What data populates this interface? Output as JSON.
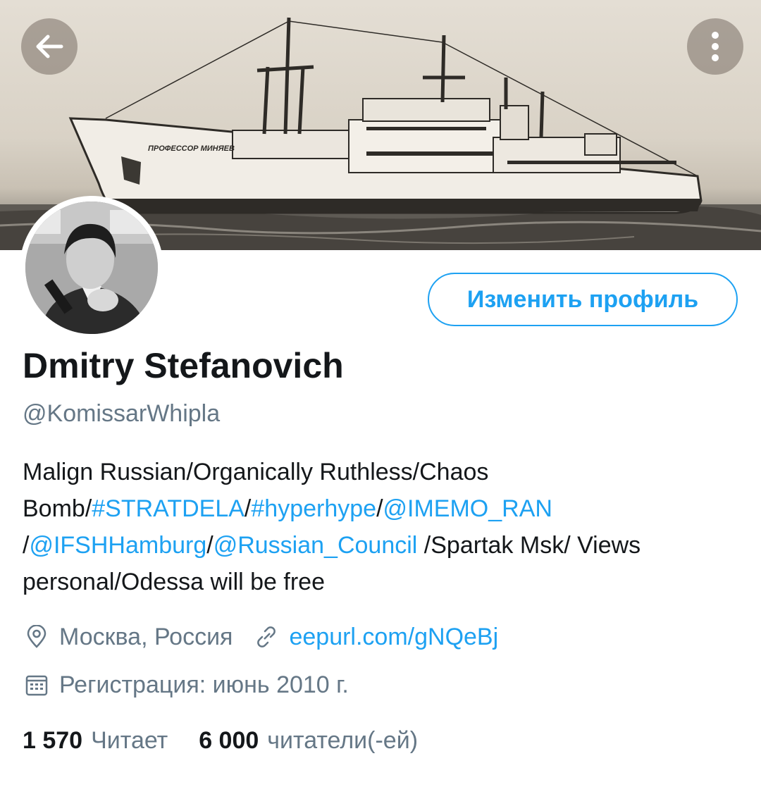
{
  "banner": {
    "ship_name": "ПРОФЕССОР МИНЯЕВ"
  },
  "profile": {
    "name": "Dmitry Stefanovich",
    "handle": "@KomissarWhipla",
    "edit_button_label": "Изменить профиль"
  },
  "bio": [
    {
      "text": "Malign Russian/Organically Ruthless/Chaos Bomb/",
      "link": false
    },
    {
      "text": "#STRATDELA",
      "link": true
    },
    {
      "text": "/",
      "link": false
    },
    {
      "text": "#hyperhype",
      "link": true
    },
    {
      "text": "/",
      "link": false
    },
    {
      "text": "@IMEMO_RAN",
      "link": true
    },
    {
      "text": " /",
      "link": false
    },
    {
      "text": "@IFSHHamburg",
      "link": true
    },
    {
      "text": "/",
      "link": false
    },
    {
      "text": "@Russian_Council",
      "link": true
    },
    {
      "text": " /Spartak Msk/ Views personal/Odessa will be free",
      "link": false
    }
  ],
  "meta": {
    "location": "Москва, Россия",
    "url": "eepurl.com/gNQeBj",
    "joined": "Регистрация: июнь 2010 г."
  },
  "stats": {
    "following_count": "1 570",
    "following_label": "Читает",
    "followers_count": "6 000",
    "followers_label": "читатели(-ей)"
  },
  "icons": {
    "back": "arrow-left-icon",
    "more": "more-vertical-icon",
    "location": "location-pin-icon",
    "link": "link-icon",
    "calendar": "calendar-icon"
  },
  "colors": {
    "accent": "#1da1f2",
    "secondary_text": "#657786",
    "primary_text": "#14171a"
  }
}
